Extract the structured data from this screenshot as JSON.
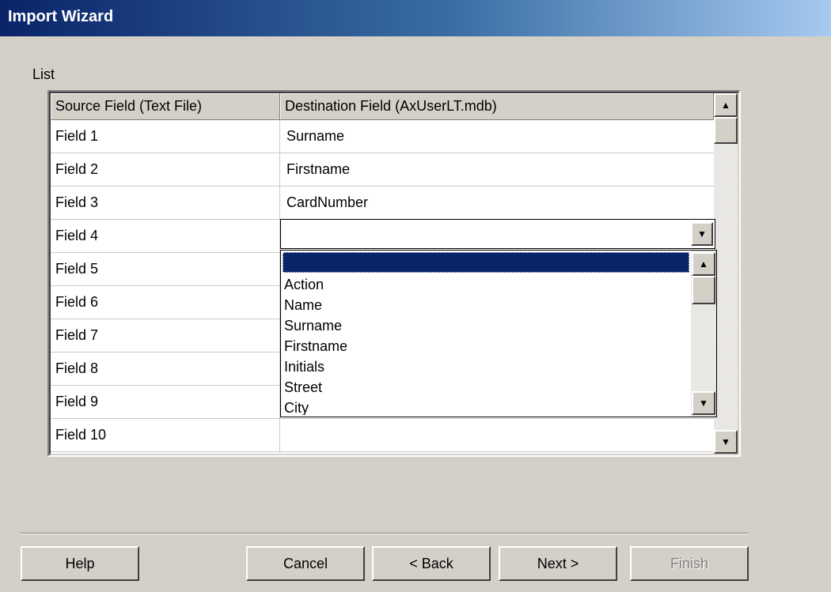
{
  "window": {
    "title": "Import Wizard"
  },
  "list_label": "List",
  "grid": {
    "headers": [
      "Source Field (Text File)",
      "Destination Field (AxUserLT.mdb)"
    ],
    "rows": [
      {
        "source": "Field 1",
        "dest": "Surname"
      },
      {
        "source": "Field 2",
        "dest": "Firstname"
      },
      {
        "source": "Field 3",
        "dest": "CardNumber"
      },
      {
        "source": "Field 4",
        "dest": ""
      },
      {
        "source": "Field 5",
        "dest": ""
      },
      {
        "source": "Field 6",
        "dest": ""
      },
      {
        "source": "Field 7",
        "dest": ""
      },
      {
        "source": "Field 8",
        "dest": ""
      },
      {
        "source": "Field 9",
        "dest": ""
      },
      {
        "source": "Field 10",
        "dest": ""
      }
    ]
  },
  "combo": {
    "value": "",
    "selected_option": "",
    "options": [
      "Action",
      "Name",
      "Surname",
      "Firstname",
      "Initials",
      "Street",
      "City"
    ]
  },
  "buttons": {
    "help": "Help",
    "cancel": "Cancel",
    "back": "< Back",
    "next": "Next >",
    "finish": "Finish"
  },
  "colors": {
    "titlebar_start": "#0a246a",
    "titlebar_end": "#a6caf0",
    "selection": "#0a246a",
    "dialog_bg": "#d4d0c8"
  },
  "icons": {
    "scroll_up": "triangle-up-icon",
    "scroll_down": "triangle-down-icon",
    "combo_dropdown": "triangle-down-icon"
  }
}
